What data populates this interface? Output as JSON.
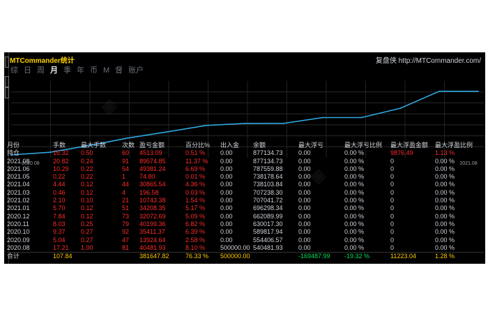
{
  "window": {
    "title": "MTCommander统计",
    "brand": "复盘侠 http://MTCommander.com/"
  },
  "tabs": [
    "综",
    "日",
    "周",
    "月",
    "季",
    "年",
    "币",
    "M",
    "督",
    "账户"
  ],
  "active_tab": "月",
  "chart_data": {
    "type": "line",
    "x": [
      "2020.08",
      "2020.09",
      "2020.10",
      "2020.11",
      "2020.12",
      "2021.01",
      "2021.02",
      "2021.03",
      "2021.04",
      "2021.05",
      "2021.06",
      "2021.07",
      "2021.08"
    ],
    "y": [
      540481.93,
      554406.57,
      589817.94,
      630017.3,
      662089.99,
      696298.34,
      707041.72,
      707238.3,
      738103.84,
      738178.64,
      787559.88,
      877134.73,
      877134.73
    ],
    "x_tick_labels": [
      "2020.08",
      "2021.08"
    ],
    "series_color": "#2fa7e0",
    "grid": true
  },
  "table": {
    "headers": [
      "月份",
      "手数",
      "最大手数",
      "次数",
      "盈亏金额",
      "百分比%",
      "出入金",
      "余额",
      "最大浮亏",
      "最大浮亏比例",
      "最大浮盈金额",
      "最大浮盈比例"
    ],
    "rows": [
      [
        "持仓",
        "16.32",
        "0.50",
        "60",
        "4513.09",
        "0.51 %",
        "0.00",
        "877134.73",
        "0.00",
        "0.00 %",
        "9876.49",
        "1.13 %"
      ],
      [
        "2021.08",
        "20.82",
        "0.24",
        "91",
        "89574.85",
        "11.37 %",
        "0.00",
        "877134.73",
        "0.00",
        "0.00 %",
        "0",
        "0.00 %"
      ],
      [
        "2021.06",
        "10.29",
        "0.22",
        "54",
        "49381.24",
        "6.69 %",
        "0.00",
        "787559.88",
        "0.00",
        "0.00 %",
        "0",
        "0.00 %"
      ],
      [
        "2021.05",
        "0.22",
        "0.22",
        "1",
        "74.80",
        "0.01 %",
        "0.00",
        "738178.64",
        "0.00",
        "0.00 %",
        "0",
        "0.00 %"
      ],
      [
        "2021.04",
        "4.44",
        "0.12",
        "44",
        "30865.54",
        "4.36 %",
        "0.00",
        "738103.84",
        "0.00",
        "0.00 %",
        "0",
        "0.00 %"
      ],
      [
        "2021.03",
        "0.46",
        "0.12",
        "4",
        "196.58",
        "0.03 %",
        "0.00",
        "707238.30",
        "0.00",
        "0.00 %",
        "0",
        "0.00 %"
      ],
      [
        "2021.02",
        "2.10",
        "0.10",
        "21",
        "10743.38",
        "1.54 %",
        "0.00",
        "707041.72",
        "0.00",
        "0.00 %",
        "0",
        "0.00 %"
      ],
      [
        "2021.01",
        "5.70",
        "0.12",
        "51",
        "34208.35",
        "5.17 %",
        "0.00",
        "696298.34",
        "0.00",
        "0.00 %",
        "0",
        "0.00 %"
      ],
      [
        "2020.12",
        "7.84",
        "0.12",
        "73",
        "32072.69",
        "5.09 %",
        "0.00",
        "662089.99",
        "0.00",
        "0.00 %",
        "0",
        "0.00 %"
      ],
      [
        "2020.11",
        "8.03",
        "0.25",
        "79",
        "40199.36",
        "6.82 %",
        "0.00",
        "630017.30",
        "0.00",
        "0.00 %",
        "0",
        "0.00 %"
      ],
      [
        "2020.10",
        "9.37",
        "0.27",
        "92",
        "35411.37",
        "6.39 %",
        "0.00",
        "589817.94",
        "0.00",
        "0.00 %",
        "0",
        "0.00 %"
      ],
      [
        "2020.09",
        "5.04",
        "0.27",
        "47",
        "13924.64",
        "2.58 %",
        "0.00",
        "554406.57",
        "0.00",
        "0.00 %",
        "0",
        "0.00 %"
      ],
      [
        "2020.08",
        "17.21",
        "1.00",
        "81",
        "40481.93",
        "8.10 %",
        "500000.00",
        "540481.93",
        "0.00",
        "0.00 %",
        "0",
        "0.00 %"
      ]
    ],
    "total": [
      "合计",
      "107.84",
      "",
      "",
      "381647.82",
      "76.33 %",
      "500000.00",
      "",
      "-169487.99",
      "-19.32 %",
      "11223.04",
      "1.28 %"
    ]
  }
}
